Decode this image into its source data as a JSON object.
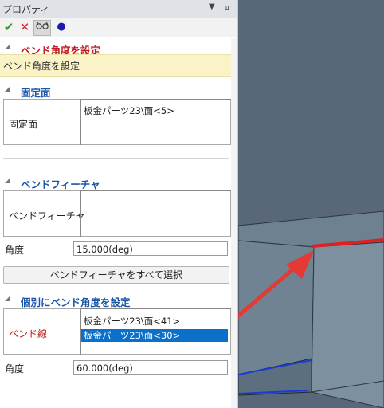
{
  "panel": {
    "title": "プロパティ",
    "pin_symbol": "ㅁ",
    "dropdown_symbol": "▼"
  },
  "toolbar": {
    "ok_symbol": "✔",
    "cancel_symbol": "✕",
    "preview_symbol": "👓",
    "dot_symbol": "●"
  },
  "sections": {
    "bend_angle_setting": {
      "title": "ベンド角度を設定",
      "description": "ベンド角度を設定"
    },
    "fixed_face": {
      "title": "固定面",
      "field_label": "固定面",
      "items": [
        "板金パーツ23\\面<5>"
      ]
    },
    "bend_feature": {
      "title": "ベンドフィーチャ",
      "field_label": "ベンドフィーチャ",
      "angle_label": "角度",
      "angle_value": "15.000(deg)",
      "select_all_button": "ベンドフィーチャをすべて選択"
    },
    "individual_angle": {
      "title": "個別にベンド角度を設定",
      "field_label": "ベンド線",
      "items": [
        "板金パーツ23\\面<41>",
        "板金パーツ23\\面<30>"
      ],
      "selected_index": 1,
      "angle_label": "角度",
      "angle_value": "60.000(deg)"
    }
  },
  "colors": {
    "accent_red": "#c11a1a",
    "accent_blue": "#1a56a8",
    "selection": "#0b70c9",
    "highlight_edge": "#e02020",
    "viewport_bg": "#586878"
  }
}
